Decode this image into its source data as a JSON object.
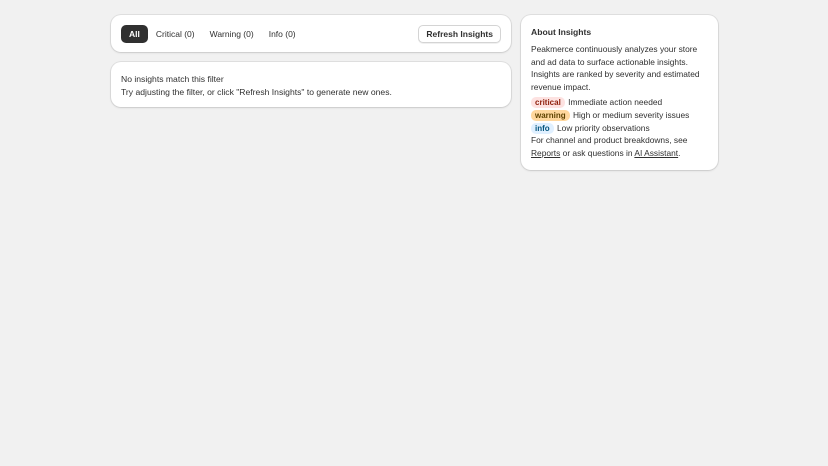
{
  "filters": {
    "tabs": [
      {
        "label": "All",
        "active": true
      },
      {
        "label": "Critical (0)",
        "active": false
      },
      {
        "label": "Warning (0)",
        "active": false
      },
      {
        "label": "Info (0)",
        "active": false
      }
    ],
    "refresh_label": "Refresh Insights"
  },
  "empty_state": {
    "title": "No insights match this filter",
    "hint": "Try adjusting the filter, or click \"Refresh Insights\" to generate new ones."
  },
  "about": {
    "title": "About Insights",
    "description": "Peakmerce continuously analyzes your store and ad data to surface actionable insights. Insights are ranked by severity and estimated revenue impact.",
    "legend": [
      {
        "badge": "critical",
        "text": "Immediate action needed",
        "color": "#fde2e1"
      },
      {
        "badge": "warning",
        "text": "High or medium severity issues",
        "color": "#ffd79d"
      },
      {
        "badge": "info",
        "text": "Low priority observations",
        "color": "#e0f0ff"
      }
    ],
    "footer_prefix": "For channel and product breakdowns, see",
    "reports_link": "Reports",
    "footer_middle": "or ask questions in",
    "assistant_link": "AI Assistant",
    "footer_suffix": "."
  }
}
